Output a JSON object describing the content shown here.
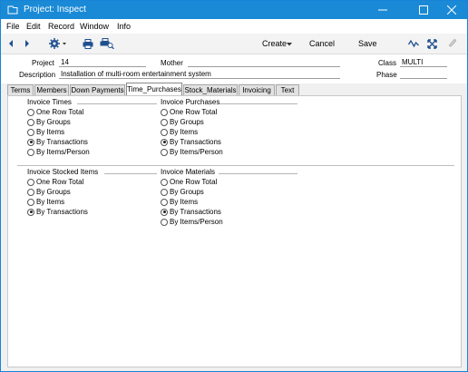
{
  "window": {
    "title": "Project: Inspect"
  },
  "menu": [
    "File",
    "Edit",
    "Record",
    "Window",
    "Info"
  ],
  "toolbar": {
    "create_label": "Create",
    "cancel_label": "Cancel",
    "save_label": "Save"
  },
  "header": {
    "project_label": "Project",
    "project_value": "14",
    "mother_label": "Mother",
    "mother_value": "",
    "class_label": "Class",
    "class_value": "MULTI",
    "description_label": "Description",
    "description_value": "Installation of multi-room entertainment system",
    "phase_label": "Phase",
    "phase_value": ""
  },
  "tabs": [
    {
      "label": "Terms"
    },
    {
      "label": "Members"
    },
    {
      "label": "Down Payments"
    },
    {
      "label": "Time_Purchases"
    },
    {
      "label": "Stock_Materials"
    },
    {
      "label": "Invoicing"
    },
    {
      "label": "Text"
    }
  ],
  "active_tab": "Time_Purchases",
  "groups": {
    "invoice_times": {
      "title": "Invoice Times",
      "options": [
        "One Row Total",
        "By Groups",
        "By Items",
        "By Transactions",
        "By Items/Person"
      ],
      "selected": "By Transactions"
    },
    "invoice_purchases": {
      "title": "Invoice Purchases",
      "options": [
        "One Row Total",
        "By Groups",
        "By Items",
        "By Transactions",
        "By Items/Person"
      ],
      "selected": "By Transactions"
    },
    "invoice_stocked_items": {
      "title": "Invoice Stocked Items",
      "options": [
        "One Row Total",
        "By Groups",
        "By Items",
        "By Transactions"
      ],
      "selected": "By Transactions"
    },
    "invoice_materials": {
      "title": "Invoice Materials",
      "options": [
        "One Row Total",
        "By Groups",
        "By Items",
        "By Transactions",
        "By Items/Person"
      ],
      "selected": "By Transactions"
    }
  },
  "colors": {
    "titlebar": "#1a8ad6",
    "accent": "#1f6fc5"
  }
}
